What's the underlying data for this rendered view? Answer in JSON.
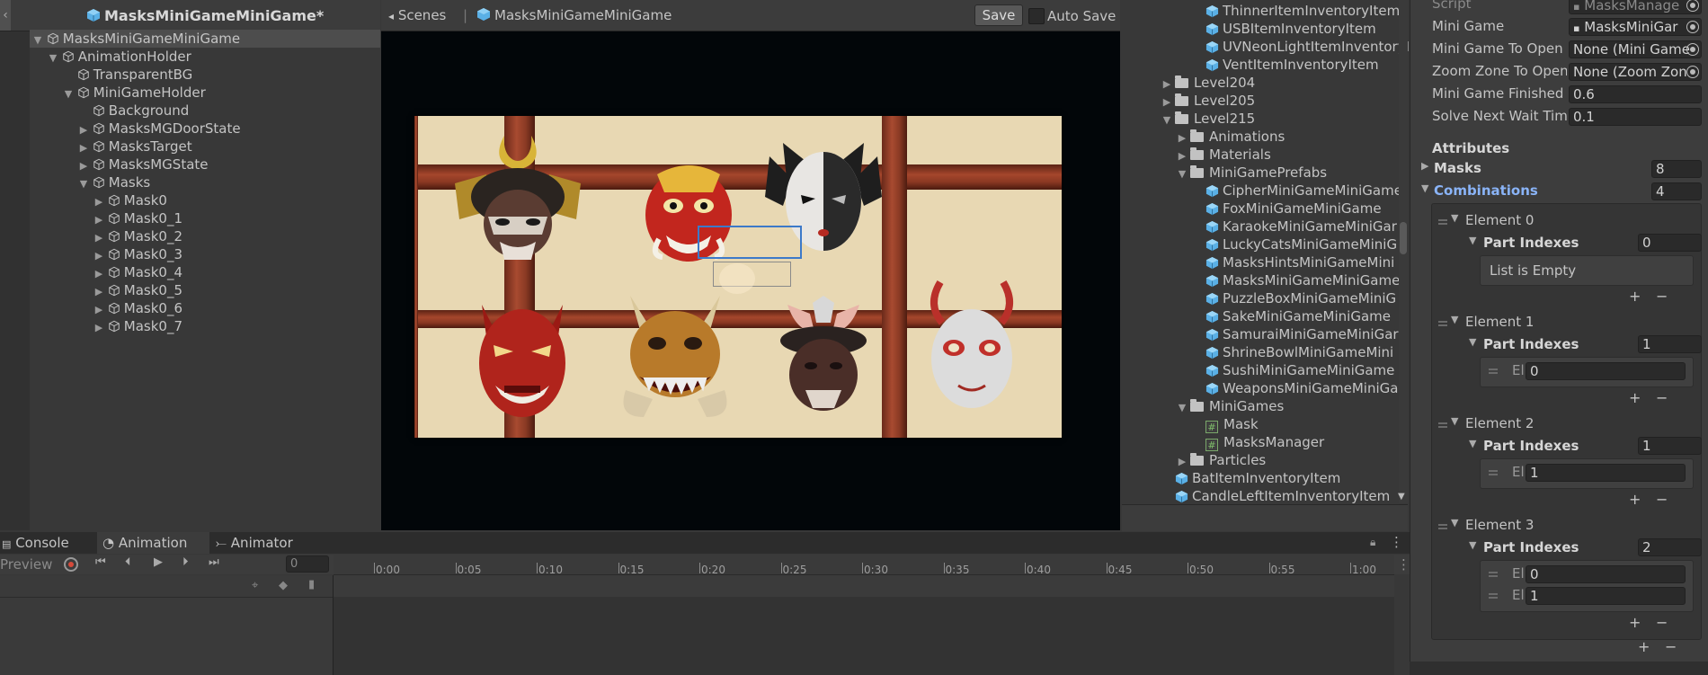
{
  "hierarchy": {
    "title": "MasksMiniGameMiniGame*",
    "rows": [
      {
        "label": "MasksMiniGameMiniGame",
        "arrow": "▼",
        "selected": true
      },
      {
        "label": "AnimationHolder",
        "arrow": "▼"
      },
      {
        "label": "TransparentBG",
        "arrow": ""
      },
      {
        "label": "MiniGameHolder",
        "arrow": "▼"
      },
      {
        "label": "Background",
        "arrow": ""
      },
      {
        "label": "MasksMGDoorState",
        "arrow": "▶"
      },
      {
        "label": "MasksTarget",
        "arrow": "▶"
      },
      {
        "label": "MasksMGState",
        "arrow": "▶"
      },
      {
        "label": "Masks",
        "arrow": "▼"
      },
      {
        "label": "Mask0",
        "arrow": "▶"
      },
      {
        "label": "Mask0_1",
        "arrow": "▶"
      },
      {
        "label": "Mask0_2",
        "arrow": "▶"
      },
      {
        "label": "Mask0_3",
        "arrow": "▶"
      },
      {
        "label": "Mask0_4",
        "arrow": "▶"
      },
      {
        "label": "Mask0_5",
        "arrow": "▶"
      },
      {
        "label": "Mask0_6",
        "arrow": "▶"
      },
      {
        "label": "Mask0_7",
        "arrow": "▶"
      }
    ]
  },
  "scene": {
    "scenes_label": "Scenes",
    "separator": "|",
    "prefab_name": "MasksMiniGameMiniGame",
    "save_label": "Save",
    "auto_save_label": "Auto Save"
  },
  "project": {
    "rows": [
      {
        "label": "ThinnerItemInventoryItem",
        "type": "prefab",
        "arrow": ""
      },
      {
        "label": "USBItemInventoryItem",
        "type": "prefab",
        "arrow": ""
      },
      {
        "label": "UVNeonLightItemInventoryIte",
        "type": "prefab",
        "arrow": ""
      },
      {
        "label": "VentItemInventoryItem",
        "type": "prefab",
        "arrow": ""
      },
      {
        "label": "Level204",
        "type": "folder",
        "arrow": "▶"
      },
      {
        "label": "Level205",
        "type": "folder",
        "arrow": "▶"
      },
      {
        "label": "Level215",
        "type": "folder",
        "arrow": "▼"
      },
      {
        "label": "Animations",
        "type": "folder",
        "arrow": "▶"
      },
      {
        "label": "Materials",
        "type": "folder",
        "arrow": "▶"
      },
      {
        "label": "MiniGamePrefabs",
        "type": "folder",
        "arrow": "▼"
      },
      {
        "label": "CipherMiniGameMiniGame",
        "type": "prefab",
        "arrow": ""
      },
      {
        "label": "FoxMiniGameMiniGame",
        "type": "prefab",
        "arrow": ""
      },
      {
        "label": "KaraokeMiniGameMiniGar",
        "type": "prefab",
        "arrow": ""
      },
      {
        "label": "LuckyCatsMiniGameMiniG",
        "type": "prefab",
        "arrow": ""
      },
      {
        "label": "MasksHintsMiniGameMini",
        "type": "prefab",
        "arrow": ""
      },
      {
        "label": "MasksMiniGameMiniGame",
        "type": "prefab",
        "arrow": ""
      },
      {
        "label": "PuzzleBoxMiniGameMiniG",
        "type": "prefab",
        "arrow": ""
      },
      {
        "label": "SakeMiniGameMiniGame",
        "type": "prefab",
        "arrow": ""
      },
      {
        "label": "SamuraiMiniGameMiniGar",
        "type": "prefab",
        "arrow": ""
      },
      {
        "label": "ShrineBowlMiniGameMini",
        "type": "prefab",
        "arrow": ""
      },
      {
        "label": "SushiMiniGameMiniGame",
        "type": "prefab",
        "arrow": ""
      },
      {
        "label": "WeaponsMiniGameMiniGa",
        "type": "prefab",
        "arrow": ""
      },
      {
        "label": "MiniGames",
        "type": "folder",
        "arrow": "▼"
      },
      {
        "label": "Mask",
        "type": "script",
        "arrow": ""
      },
      {
        "label": "MasksManager",
        "type": "script",
        "arrow": ""
      },
      {
        "label": "Particles",
        "type": "folder",
        "arrow": "▶"
      },
      {
        "label": "BatItemInventoryItem",
        "type": "prefab",
        "arrow": ""
      },
      {
        "label": "CandleLeftItemInventoryItem",
        "type": "prefab",
        "arrow": ""
      }
    ]
  },
  "inspector": {
    "script_label": "Script",
    "script_value": "MasksManage",
    "mini_game_label": "Mini Game",
    "mini_game_value": "MasksMiniGar",
    "mini_game_open_label": "Mini Game To Open (",
    "mini_game_open_value": "None (Mini Game",
    "zoom_zone_label": "Zoom Zone To Open",
    "zoom_zone_value": "None (Zoom Zon",
    "finished_label": "Mini Game Finished I",
    "finished_value": "0.6",
    "solve_label": "Solve Next Wait Time",
    "solve_value": "0.1",
    "attributes_header": "Attributes",
    "masks_label": "Masks",
    "masks_value": "8",
    "combinations_label": "Combinations",
    "combinations_value": "4",
    "part_indexes_label": "Part Indexes",
    "list_empty": "List is Empty",
    "el_label": "El",
    "plus": "+",
    "minus": "−",
    "elements": [
      {
        "label": "Element 0",
        "count": "0",
        "items": []
      },
      {
        "label": "Element 1",
        "count": "1",
        "items": [
          "0"
        ]
      },
      {
        "label": "Element 2",
        "count": "1",
        "items": [
          "1"
        ]
      },
      {
        "label": "Element 3",
        "count": "2",
        "items": [
          "0",
          "1"
        ]
      }
    ]
  },
  "bottom": {
    "console_tab": "Console",
    "animation_tab": "Animation",
    "animator_tab": "Animator",
    "preview_label": "Preview",
    "frame_value": "0",
    "ticks": [
      "0:00",
      "0:05",
      "0:10",
      "0:15",
      "0:20",
      "0:25",
      "0:30",
      "0:35",
      "0:40",
      "0:45",
      "0:50",
      "0:55",
      "1:00"
    ]
  },
  "colors": {
    "selection_blue": "#3c79c9",
    "prefab_cube": "#5ab0e6",
    "accent_link": "#8ab4f8"
  }
}
